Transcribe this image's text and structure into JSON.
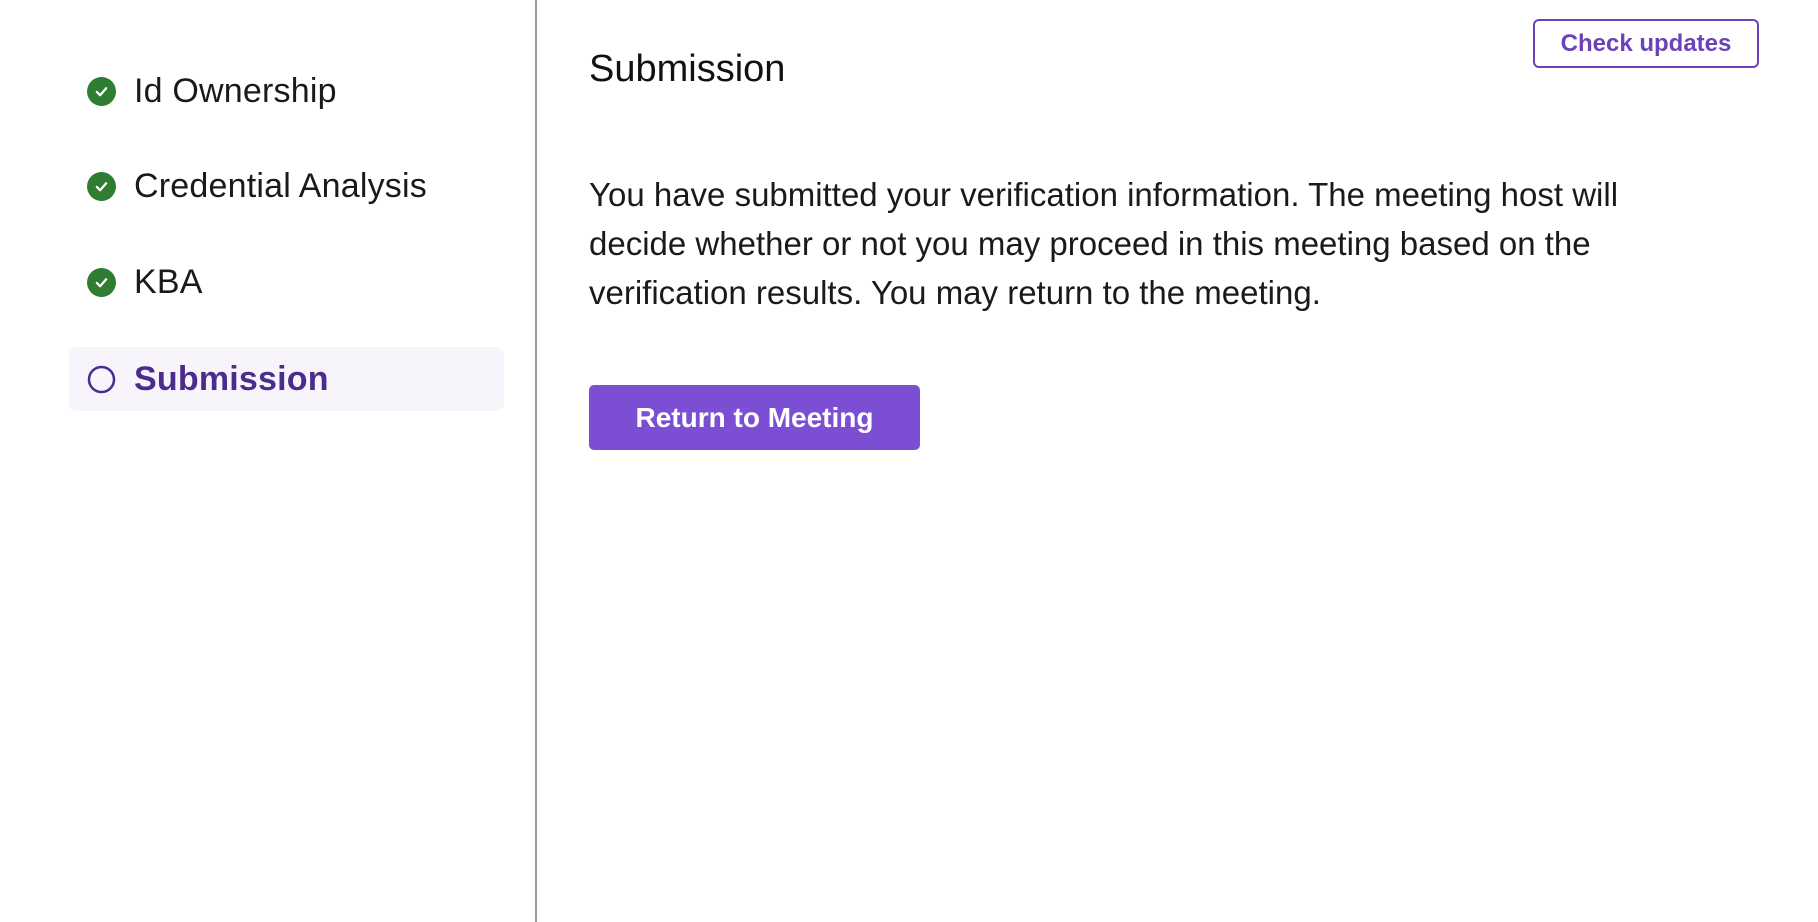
{
  "sidebar": {
    "steps": [
      {
        "label": "Id Ownership",
        "status": "complete"
      },
      {
        "label": "Credential Analysis",
        "status": "complete"
      },
      {
        "label": "KBA",
        "status": "complete"
      },
      {
        "label": "Submission",
        "status": "current"
      }
    ]
  },
  "header": {
    "check_updates_label": "Check updates"
  },
  "main": {
    "title": "Submission",
    "message": "You have submitted your verification information. The meeting host will decide whether or not you may proceed in this meeting based on the verification results. You may return to the meeting.",
    "return_button_label": "Return to Meeting"
  },
  "colors": {
    "complete_check": "#2e7d32",
    "accent": "#7b4ed4",
    "active_text": "#4a2c8a",
    "active_background": "#f7f4fc"
  },
  "icons": {
    "complete": "check-circle-icon",
    "current": "empty-circle-icon"
  }
}
